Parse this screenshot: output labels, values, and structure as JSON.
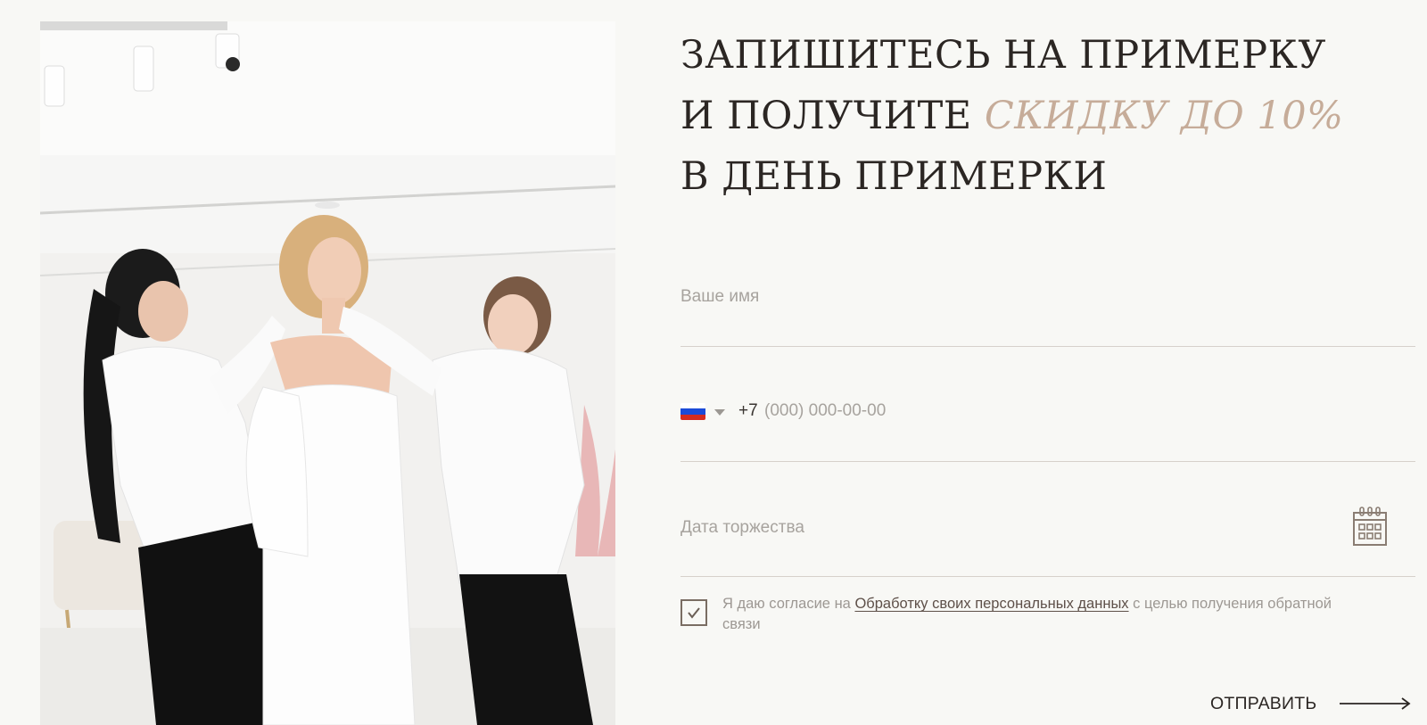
{
  "headline": {
    "line1": "ЗАПИШИТЕСЬ НА ПРИМЕРКУ",
    "line2_pre": "И ПОЛУЧИТЕ",
    "line2_accent": "СКИДКУ ДО 10%",
    "line3": "В ДЕНЬ ПРИМЕРКИ"
  },
  "form": {
    "name_placeholder": "Ваше имя",
    "phone": {
      "country_flag": "russia-flag",
      "dial_code": "+7",
      "placeholder": "(000) 000-00-00"
    },
    "date_placeholder": "Дата торжества",
    "consent": {
      "checked": true,
      "text_before": "Я даю согласие на ",
      "link_text": "Обработку своих персональных данных",
      "text_after": " с целью получения обратной связи"
    },
    "submit_label": "ОТПРАВИТЬ"
  },
  "colors": {
    "background": "#f8f8f5",
    "text_dark": "#2b2623",
    "accent": "#c6ac99",
    "placeholder": "#a7a39e",
    "divider": "#d6d1cb"
  },
  "icons": [
    "calendar-icon",
    "check-icon",
    "arrow-right-icon",
    "chevron-down-icon"
  ]
}
